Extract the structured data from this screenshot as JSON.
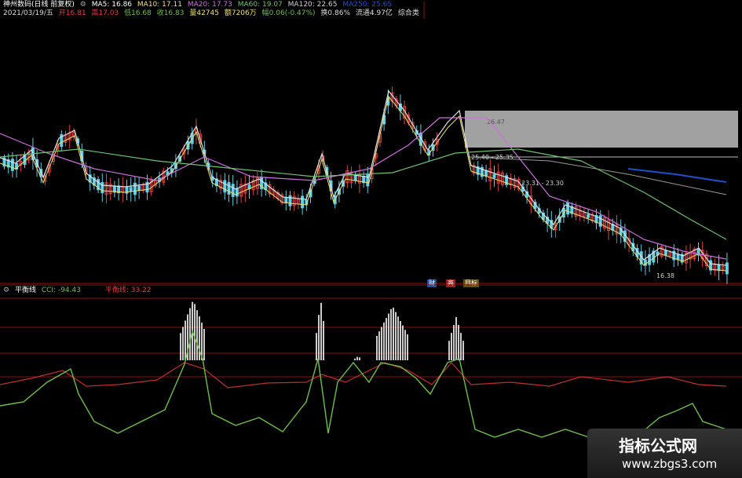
{
  "header_line1": {
    "stock": "神州数码(日线 前复权)",
    "ma5": "MA5: 16.86",
    "ma10": "MA10: 17.11",
    "ma20": "MA20: 17.73",
    "ma60": "MA60: 19.07",
    "ma120": "MA120: 22.65",
    "ma250": "MA250: 25.65"
  },
  "header_line2": {
    "date": "2021/03/19/五",
    "open": "开16.81",
    "high": "高17.03",
    "low": "低16.68",
    "close": "收16.83",
    "volume": "量42745",
    "amount": "额7206万",
    "change": "幅0.06(-0.47%)",
    "turnover": "换0.86%",
    "circulation": "流通4.97亿",
    "category": "综合类"
  },
  "price_labels": {
    "band_top": "26.47",
    "band_mid": "25.40 - 25.35",
    "level_2": "23.31 - 23.30",
    "low": "16.38"
  },
  "markers": {
    "m1": "财",
    "m2": "高",
    "m3": "目标"
  },
  "indicator": {
    "name": "平衡线",
    "cci": "CCI: -94.43",
    "balance": "平衡线: 33.22"
  },
  "watermark": {
    "title": "指标公式网",
    "url": "www.zbgs3.com"
  },
  "colors": {
    "up": "#e04040",
    "down": "#5fd0e8",
    "ma5": "#e0e0e0",
    "ma10": "#f0e070",
    "ma20": "#d070e0",
    "ma60": "#70c070",
    "ma120": "#2050d0",
    "cci_line": "#6fbf4a",
    "balance_line": "#c03030",
    "grid_red": "#8a1010"
  }
}
